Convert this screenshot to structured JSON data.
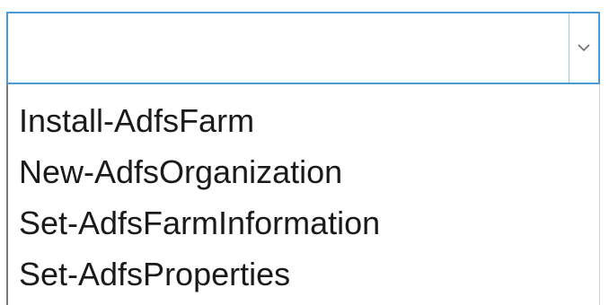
{
  "dropdown": {
    "selected_value": "",
    "options": [
      "Install-AdfsFarm",
      "New-AdfsOrganization",
      "Set-AdfsFarmInformation",
      "Set-AdfsProperties"
    ]
  },
  "icons": {
    "expand": "chevron-down-icon"
  },
  "colors": {
    "focus_border": "#4a9ad4",
    "list_text": "#1a1a1a"
  }
}
